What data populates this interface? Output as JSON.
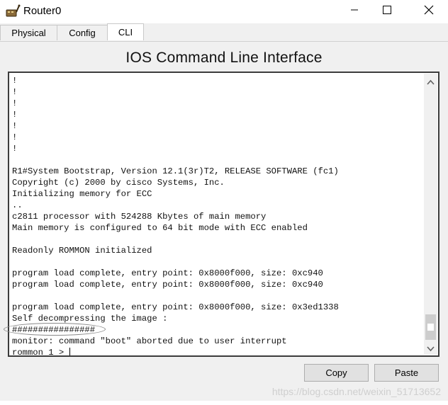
{
  "window": {
    "title": "Router0",
    "app_icon": "router-device-icon",
    "minimize_icon": "minimize-icon",
    "maximize_icon": "maximize-icon",
    "close_icon": "close-icon"
  },
  "tabs": [
    {
      "label": "Physical",
      "active": false
    },
    {
      "label": "Config",
      "active": false
    },
    {
      "label": "CLI",
      "active": true
    }
  ],
  "content_title": "IOS Command Line Interface",
  "terminal": {
    "lines": [
      "!",
      "!",
      "!",
      "!",
      "!",
      "!",
      "!",
      "",
      "R1#System Bootstrap, Version 12.1(3r)T2, RELEASE SOFTWARE (fc1)",
      "Copyright (c) 2000 by cisco Systems, Inc.",
      "Initializing memory for ECC",
      "..",
      "c2811 processor with 524288 Kbytes of main memory",
      "Main memory is configured to 64 bit mode with ECC enabled",
      "",
      "Readonly ROMMON initialized",
      "",
      "program load complete, entry point: 0x8000f000, size: 0xc940",
      "program load complete, entry point: 0x8000f000, size: 0xc940",
      "",
      "program load complete, entry point: 0x8000f000, size: 0x3ed1338",
      "Self decompressing the image :",
      "################",
      "monitor: command \"boot\" aborted due to user interrupt",
      "rommon 1 > "
    ],
    "scroll_up_icon": "chevron-up-icon",
    "scroll_down_icon": "chevron-down-icon"
  },
  "buttons": {
    "copy": "Copy",
    "paste": "Paste"
  },
  "watermark": "https://blog.csdn.net/weixin_51713652",
  "colors": {
    "background": "#f0f0f0",
    "terminal_bg": "#ffffff",
    "terminal_border": "#3c3c3c",
    "button_bg": "#e1e1e1"
  }
}
